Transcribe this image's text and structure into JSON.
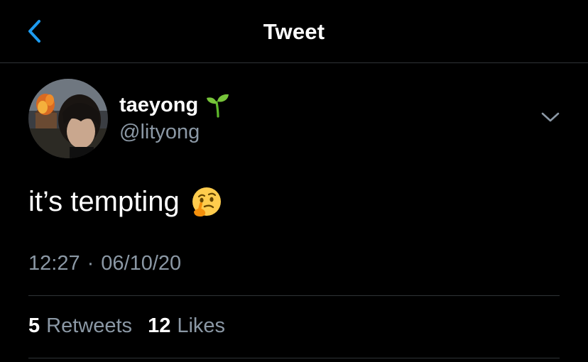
{
  "header": {
    "title": "Tweet",
    "back_icon": "chevron-left-icon"
  },
  "author": {
    "display_name": "taeyong",
    "name_emoji": "seedling-emoji",
    "handle": "@lityong",
    "avatar": "profile-photo"
  },
  "tweet": {
    "text": "it’s tempting",
    "emoji": "thinking-face-emoji",
    "time": "12:27",
    "separator": "·",
    "date": "06/10/20"
  },
  "stats": {
    "retweets_count": "5",
    "retweets_label": "Retweets",
    "likes_count": "12",
    "likes_label": "Likes"
  },
  "colors": {
    "background": "#000000",
    "accent": "#1d9bf0",
    "secondary_text": "#8b98a5",
    "divider": "#2f3336"
  }
}
